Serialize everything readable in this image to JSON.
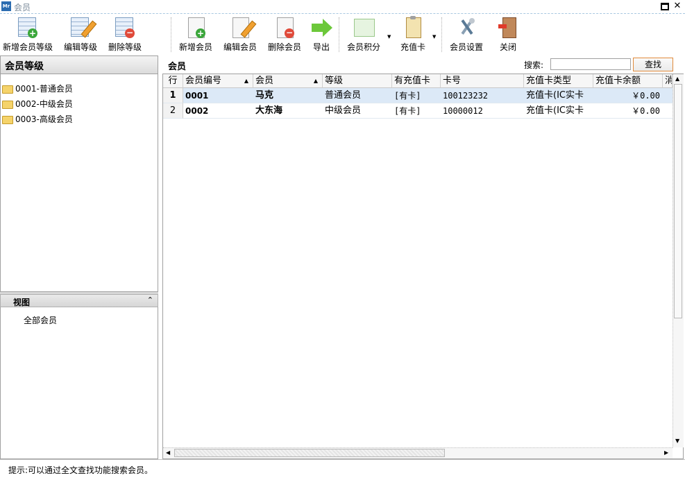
{
  "window": {
    "title": "会员",
    "app_icon_text": "Mr"
  },
  "toolbar": {
    "buttons": [
      {
        "label": "新增会员等级",
        "icon": "add-level-icon"
      },
      {
        "label": "编辑等级",
        "icon": "edit-level-icon"
      },
      {
        "label": "删除等级",
        "icon": "delete-level-icon"
      },
      {
        "label": "新增会员",
        "icon": "add-member-icon"
      },
      {
        "label": "编辑会员",
        "icon": "edit-member-icon"
      },
      {
        "label": "删除会员",
        "icon": "delete-member-icon"
      },
      {
        "label": "导出",
        "icon": "export-arrow-icon"
      },
      {
        "label": "会员积分",
        "icon": "points-chart-icon"
      },
      {
        "label": "充值卡",
        "icon": "card-clipboard-icon"
      },
      {
        "label": "会员设置",
        "icon": "tools-icon"
      },
      {
        "label": "关闭",
        "icon": "exit-door-icon"
      }
    ]
  },
  "left_panel": {
    "title": "会员等级",
    "levels": [
      {
        "label": "0001-普通会员"
      },
      {
        "label": "0002-中级会员"
      },
      {
        "label": "0003-高级会员"
      }
    ],
    "view_title": "视图",
    "view_items": [
      {
        "label": "全部会员"
      }
    ]
  },
  "main": {
    "title": "会员",
    "search_label": "搜索:",
    "search_value": "",
    "search_button": "查找",
    "columns": [
      "行",
      "会员编号",
      "会员",
      "等级",
      "有充值卡",
      "卡号",
      "充值卡类型",
      "充值卡余额",
      "消"
    ],
    "rows": [
      {
        "row": "1",
        "id": "0001",
        "name": "马克",
        "level": "普通会员",
        "has_card": "[有卡]",
        "card_no": "100123232",
        "card_type": "充值卡(IC实卡",
        "balance": "￥0.00"
      },
      {
        "row": "2",
        "id": "0002",
        "name": "大东海",
        "level": "中级会员",
        "has_card": "[有卡]",
        "card_no": "10000012",
        "card_type": "充值卡(IC实卡",
        "balance": "￥0.00"
      }
    ]
  },
  "status": {
    "hint": "提示:可以通过全文查找功能搜索会员。"
  }
}
